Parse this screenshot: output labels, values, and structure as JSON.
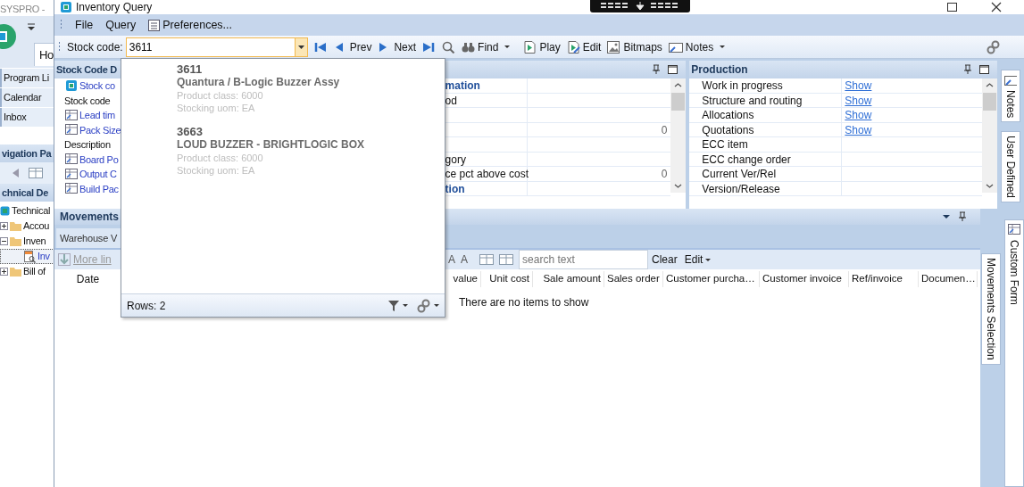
{
  "background_window": {
    "title": "SYSPRO -",
    "ribbon_tab": "Ho",
    "nav_items": [
      "Program Li",
      "Calendar",
      "Inbox"
    ],
    "navigation_pane_title": "vigation Pa",
    "tree_title": "chnical De",
    "tree": [
      {
        "label": "Technical",
        "kind": "root",
        "selected": false,
        "children": [
          {
            "label": "Accou",
            "kind": "folder",
            "expanded": false,
            "selected": false
          },
          {
            "label": "Inven",
            "kind": "folder",
            "expanded": true,
            "selected": false,
            "children": [
              {
                "label": "Inv",
                "kind": "query",
                "selected": true
              }
            ]
          },
          {
            "label": "Bill of",
            "kind": "folder",
            "expanded": false,
            "selected": false
          }
        ]
      }
    ]
  },
  "window": {
    "title": "Inventory Query"
  },
  "menu": [
    {
      "label": "File",
      "kind": "plain"
    },
    {
      "label": "Query",
      "kind": "plain"
    },
    {
      "label": "Preferences...",
      "kind": "prefs"
    }
  ],
  "toolbar": {
    "stock_code_label": "Stock code:",
    "stock_code_value": "3611",
    "items": [
      {
        "kind": "first"
      },
      {
        "kind": "prev",
        "label": "Prev"
      },
      {
        "kind": "next",
        "label": "Next"
      },
      {
        "kind": "last"
      },
      {
        "kind": "search"
      },
      {
        "kind": "find",
        "label": "Find",
        "has_menu": true
      },
      {
        "kind": "play",
        "label": "Play"
      },
      {
        "kind": "edit",
        "label": "Edit"
      },
      {
        "kind": "bitmaps",
        "label": "Bitmaps"
      },
      {
        "kind": "notes",
        "label": "Notes",
        "has_menu": true
      }
    ]
  },
  "stock_panel": {
    "title": "Stock Code D",
    "rows": [
      {
        "kind": "logo-link",
        "label": "Stock co"
      },
      {
        "kind": "plain",
        "label": "Stock code"
      },
      {
        "kind": "table-link",
        "label": "Lead tim"
      },
      {
        "kind": "table-link",
        "label": "Pack Size"
      },
      {
        "kind": "plain",
        "label": "Description"
      },
      {
        "kind": "table-link",
        "label": "Board Po"
      },
      {
        "kind": "table-link",
        "label": "Output C"
      },
      {
        "kind": "table-link",
        "label": "Build Pac"
      }
    ]
  },
  "detail_panel": {
    "rows": [
      {
        "kind": "heading",
        "label": "mation"
      },
      {
        "kind": "field",
        "label": "od"
      },
      {
        "kind": "field"
      },
      {
        "kind": "field",
        "value": "0"
      },
      {
        "kind": "field"
      },
      {
        "kind": "field",
        "label": "gory"
      },
      {
        "kind": "field",
        "label": "ce pct above cost",
        "value": "0"
      },
      {
        "kind": "heading",
        "label": "tion"
      }
    ]
  },
  "production": {
    "title": "Production",
    "rows": [
      {
        "label": "Work in progress",
        "link": "Show"
      },
      {
        "label": "Structure and routing",
        "link": "Show"
      },
      {
        "label": "Allocations",
        "link": "Show"
      },
      {
        "label": "Quotations",
        "link": "Show"
      },
      {
        "label": "ECC item"
      },
      {
        "label": "ECC change order"
      },
      {
        "label": "Current Ver/Rel"
      },
      {
        "label": "Version/Release"
      }
    ]
  },
  "side_tabs": [
    {
      "label": "Notes",
      "kind": "notes"
    },
    {
      "label": "User Defined",
      "kind": "plain"
    }
  ],
  "movements": {
    "title": "Movements",
    "tab": "Warehouse V",
    "more_lines": "More lin",
    "font_buttons": [
      "A",
      "A"
    ],
    "search": {
      "placeholder": "search text"
    },
    "clear": "Clear",
    "edit": "Edit",
    "first_column": "Date",
    "columns": [
      "value",
      "Unit cost",
      "Sale amount",
      "Sales order",
      "Customer purcha…",
      "Customer invoice",
      "Ref/invoice",
      "Documen…"
    ],
    "empty_message": "There are no items to show",
    "side_tabs": [
      {
        "label": "Movements Selection",
        "kind": "plain"
      },
      {
        "label": "Custom Form",
        "kind": "form"
      }
    ]
  },
  "dropdown": {
    "items": [
      {
        "code": "3611",
        "description": "Quantura / B-Logic Buzzer Assy",
        "product_class": "Product class: 6000",
        "uom": "Stocking uom: EA"
      },
      {
        "code": "3663",
        "description": "LOUD BUZZER - BRIGHTLOGIC BOX",
        "product_class": "Product class: 6000",
        "uom": "Stocking uom: EA"
      }
    ],
    "rows_label": "Rows:  2"
  }
}
